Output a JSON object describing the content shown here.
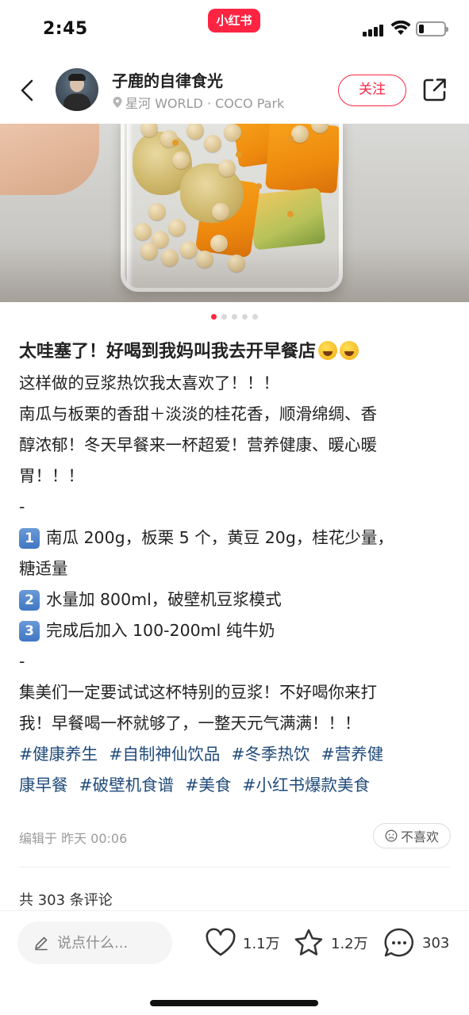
{
  "status_bar": {
    "time": "2:45",
    "app_logo": "小红书"
  },
  "header": {
    "user_name": "子鹿的自律食光",
    "location": "星河 WORLD · COCO Park",
    "follow_label": "关注",
    "icons": [
      "back-icon",
      "location-pin-icon",
      "share-icon"
    ]
  },
  "carousel": {
    "total": 5,
    "active_index": 0
  },
  "post": {
    "title": "太哇塞了！好喝到我妈叫我去开早餐店",
    "title_emojis": [
      "rolling-laughing-emoji",
      "rolling-laughing-emoji"
    ],
    "lines": [
      "这样做的豆浆热饮我太喜欢了！！！",
      "南瓜与板栗的香甜＋淡淡的桂花香，顺滑绵绸、香",
      "醇浓郁！冬天早餐来一杯超爱！营养健康、暖心暖",
      "胃！！！",
      "-"
    ],
    "steps": [
      {
        "num": "1",
        "text_line1": "南瓜 200g，板栗 5 个，黄豆 20g，桂花少量，",
        "text_line2": "糖适量"
      },
      {
        "num": "2",
        "text_line1": "水量加 800ml，破壁机豆浆模式"
      },
      {
        "num": "3",
        "text_line1": "完成后加入 100-200ml 纯牛奶"
      }
    ],
    "separator": "-",
    "closing_lines": [
      "集美们一定要试试这杯特别的豆浆！不好喝你来打",
      "我！早餐喝一杯就够了，一整天元气满满！！！"
    ],
    "tags": [
      "#健康养生",
      "#自制神仙饮品",
      "#冬季热饮",
      "#营养健",
      "康早餐",
      "#破壁机食谱",
      "#美食",
      "#小红书爆款美食"
    ],
    "edit_time": "编辑于 昨天 00:06",
    "dislike_label": "不喜欢"
  },
  "comments": {
    "count_label": "共 303 条评论"
  },
  "bottom_bar": {
    "input_placeholder": "说点什么...",
    "likes": "1.1万",
    "favorites": "1.2万",
    "comments": "303"
  },
  "colors": {
    "brand": "#ff2442",
    "tag": "#1f4a7a",
    "muted": "#999999"
  }
}
